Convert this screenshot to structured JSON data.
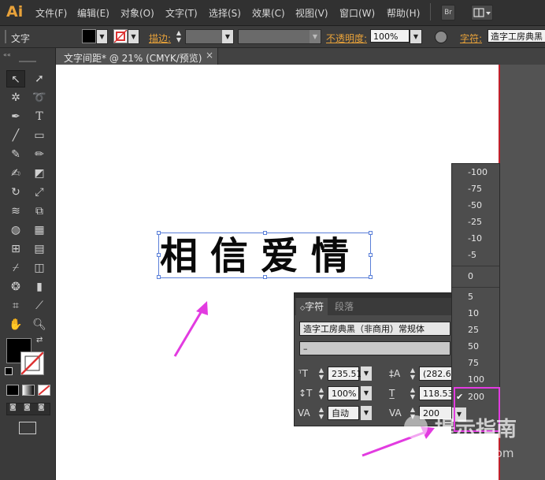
{
  "app": {
    "logo": "Ai"
  },
  "menu": [
    "文件(F)",
    "编辑(E)",
    "对象(O)",
    "文字(T)",
    "选择(S)",
    "效果(C)",
    "视图(V)",
    "窗口(W)",
    "帮助(H)"
  ],
  "menubar_buttons": {
    "bridge": "Br"
  },
  "control_bar": {
    "tool_name": "文字",
    "stroke_label": "描边:",
    "opacity_label": "不透明度:",
    "opacity_value": "100%",
    "char_label": "字符:",
    "font_value": "造字工房典黑"
  },
  "document_tab": {
    "title": "文字间距* @ 21% (CMYK/预览)",
    "close": "×"
  },
  "canvas_text": "相信爱情",
  "char_panel": {
    "tabs": [
      "字符",
      "段落"
    ],
    "font_family": "造字工房典黑（非商用）常规体",
    "font_style": "–",
    "font_size": "235.51",
    "leading": "(282.6",
    "vertical_scale": "100%",
    "horizontal_scale": "118.53",
    "kerning": "自动",
    "tracking": "200"
  },
  "tracking_options": [
    "-100",
    "-75",
    "-50",
    "-25",
    "-10",
    "-5",
    "0",
    "5",
    "10",
    "25",
    "50",
    "75",
    "100",
    "200"
  ],
  "tracking_selected": "200",
  "watermark": {
    "text": "提示指南",
    "url": "zhinan.sogou.com"
  },
  "colors": {
    "accent_pink": "#e23be0",
    "selection_blue": "#5a7fd8",
    "orange_label": "#e8a23a"
  }
}
